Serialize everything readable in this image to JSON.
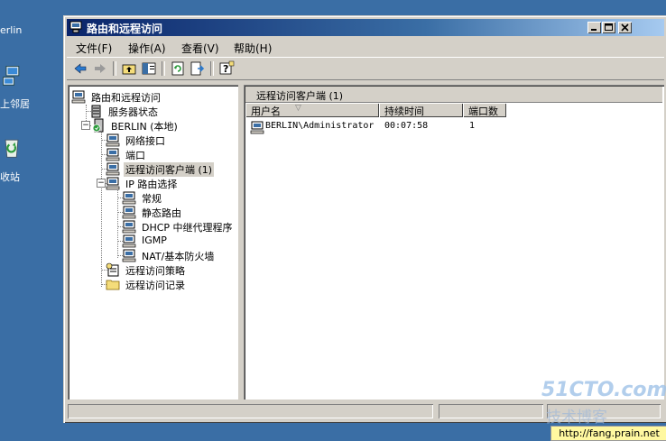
{
  "desktop": {
    "icons": [
      {
        "label": "erlin"
      },
      {
        "label": "上邻居"
      },
      {
        "label": "收站"
      }
    ]
  },
  "window": {
    "title": "路由和远程访问",
    "menu": [
      "文件(F)",
      "操作(A)",
      "查看(V)",
      "帮助(H)"
    ],
    "toolbar": [
      "back",
      "forward",
      "up-folder",
      "show-hide-tree",
      "refresh",
      "export-list",
      "help"
    ]
  },
  "tree": {
    "root": "路由和远程访问",
    "server_status": "服务器状态",
    "server": "BERLIN (本地)",
    "network_interfaces": "网络接口",
    "ports": "端口",
    "remote_clients": "远程访问客户端 (1)",
    "ip_routing": "IP 路由选择",
    "general": "常规",
    "static_routes": "静态路由",
    "dhcp_relay": "DHCP 中继代理程序",
    "igmp": "IGMP",
    "nat": "NAT/基本防火墙",
    "policies": "远程访问策略",
    "logging": "远程访问记录"
  },
  "details": {
    "title": "远程访问客户端 (1)",
    "columns": [
      "用户名",
      "持续时间",
      "端口数"
    ],
    "sort_indicator": "▽",
    "rows": [
      {
        "user": "BERLIN\\Administrator",
        "duration": "00:07:58",
        "ports": "1"
      }
    ]
  },
  "watermark": {
    "brand": "51CTO.com",
    "cn": "技术博客",
    "url": "http://fang.prain.net"
  },
  "colors": {
    "desktop": "#3a6ea5",
    "title_from": "#0a246a",
    "title_to": "#a6caf0",
    "face": "#d4d0c8"
  }
}
